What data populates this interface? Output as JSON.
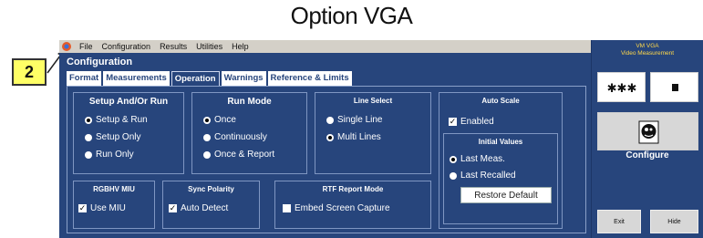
{
  "page_heading": "Option VGA",
  "callout": {
    "number": "2"
  },
  "menubar": {
    "items": [
      "File",
      "Configuration",
      "Results",
      "Utilities",
      "Help"
    ]
  },
  "config_title": "Configuration",
  "tabs": [
    {
      "label": "Format",
      "active": false
    },
    {
      "label": "Measurements",
      "active": false
    },
    {
      "label": "Operation",
      "active": true
    },
    {
      "label": "Warnings",
      "active": false
    },
    {
      "label": "Reference & Limits",
      "active": false
    }
  ],
  "setup_run": {
    "title": "Setup And/Or Run",
    "options": [
      "Setup & Run",
      "Setup Only",
      "Run Only"
    ],
    "selected": "Setup & Run"
  },
  "run_mode": {
    "title": "Run Mode",
    "options": [
      "Once",
      "Continuously",
      "Once & Report"
    ],
    "selected": "Once"
  },
  "line_select": {
    "title": "Line Select",
    "options": [
      "Single Line",
      "Multi Lines"
    ],
    "selected": "Multi Lines"
  },
  "auto_scale": {
    "title": "Auto Scale",
    "enabled_label": "Enabled",
    "enabled": true,
    "initial_values": {
      "title": "Initial Values",
      "options": [
        "Last Meas.",
        "Last Recalled"
      ],
      "selected": "Last Meas."
    },
    "restore_label": "Restore Default"
  },
  "rgbhv": {
    "title": "RGBHV MIU",
    "label": "Use MIU",
    "checked": true
  },
  "sync_polarity": {
    "title": "Sync Polarity",
    "label": "Auto Detect",
    "checked": true
  },
  "rtf_report": {
    "title": "RTF Report Mode",
    "label": "Embed Screen Capture",
    "checked": false
  },
  "side_panel": {
    "title_line1": "VM VGA",
    "title_line2": "Video Measurement",
    "configure_label": "Configure",
    "exit_label": "Exit",
    "hide_label": "Hide"
  },
  "colors": {
    "app_background": "#27457c",
    "menubar": "#d4d0c8",
    "callout": "#ffff66",
    "side_title": "#ffd84a"
  }
}
